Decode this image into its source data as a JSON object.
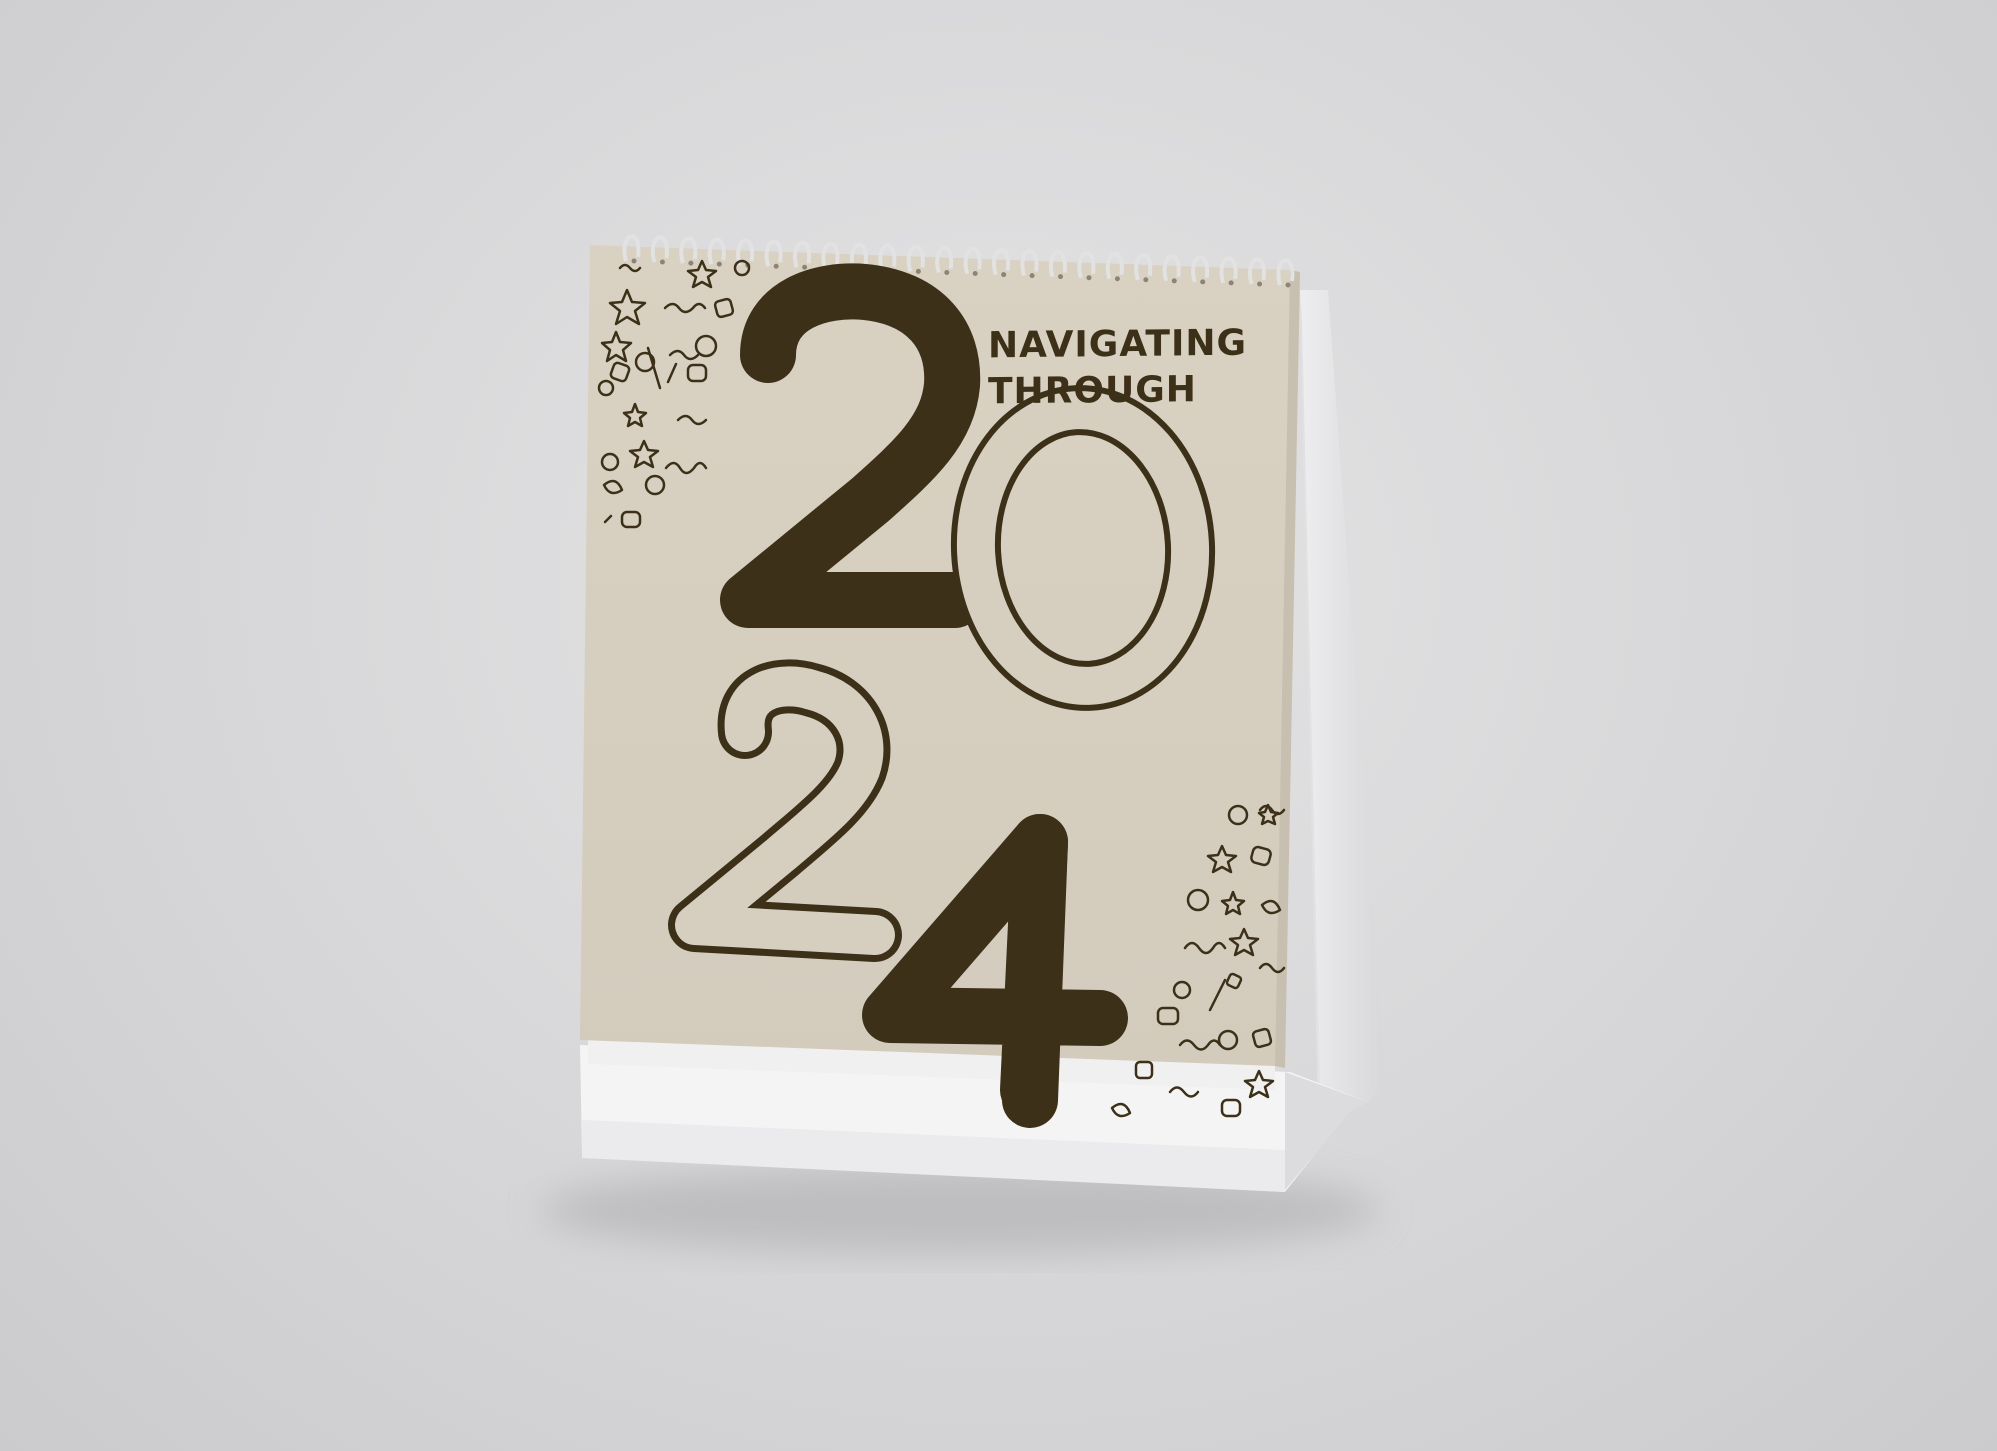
{
  "calendar": {
    "cover_title_line1": "NAVIGATING",
    "cover_title_line2": "THROUGH",
    "year_digits": [
      "2",
      "0",
      "2",
      "4"
    ]
  },
  "colors": {
    "background": "#d9d9db",
    "cover": "#d6cfc0",
    "ink": "#3d3019",
    "stand": "#f3f3f4",
    "wire": "#e9e9ea"
  },
  "icons": [
    "star-doodle",
    "blob-doodle",
    "squiggle-doodle",
    "pencil-doodle",
    "leaf-doodle",
    "apple-doodle"
  ]
}
